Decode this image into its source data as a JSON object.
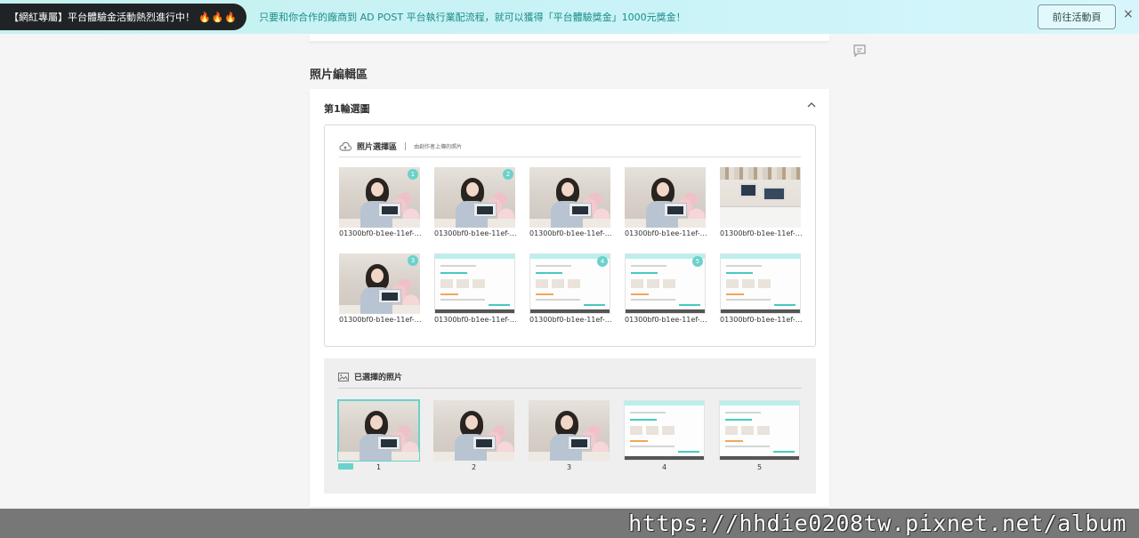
{
  "banner": {
    "badge": "【網紅專屬】平台體驗金活動熱烈進行中！",
    "fire": "🔥🔥🔥",
    "message": "只要和你合作的廠商到 AD POST 平台執行業配流程，就可以獲得「平台體驗獎金」1000元獎金！",
    "cta": "前往活動頁",
    "close": "×"
  },
  "section_title": "照片編輯區",
  "round": {
    "title": "第1輪選圖",
    "picker": {
      "label": "照片選擇區",
      "separator": "|",
      "hint": "由創作者上傳的照片",
      "items": [
        {
          "caption": "01300bf0-b1ee-11ef-…",
          "badge": "1",
          "kind": "photo"
        },
        {
          "caption": "01300bf0-b1ee-11ef-…",
          "badge": "2",
          "kind": "photo"
        },
        {
          "caption": "01300bf0-b1ee-11ef-…",
          "badge": "",
          "kind": "photo"
        },
        {
          "caption": "01300bf0-b1ee-11ef-…",
          "badge": "",
          "kind": "photo"
        },
        {
          "caption": "01300bf0-b1ee-11ef-…",
          "badge": "",
          "kind": "desk"
        },
        {
          "caption": "01300bf0-b1ee-11ef-…",
          "badge": "3",
          "kind": "photo"
        },
        {
          "caption": "01300bf0-b1ee-11ef-…",
          "badge": "",
          "kind": "shot"
        },
        {
          "caption": "01300bf0-b1ee-11ef-…",
          "badge": "4",
          "kind": "shot"
        },
        {
          "caption": "01300bf0-b1ee-11ef-…",
          "badge": "5",
          "kind": "shot"
        },
        {
          "caption": "01300bf0-b1ee-11ef-…",
          "badge": "",
          "kind": "shot"
        }
      ]
    },
    "selected": {
      "label": "已選擇的照片",
      "items": [
        {
          "index": "1",
          "kind": "photo"
        },
        {
          "index": "2",
          "kind": "photo"
        },
        {
          "index": "3",
          "kind": "photo"
        },
        {
          "index": "4",
          "kind": "shot"
        },
        {
          "index": "5",
          "kind": "shot"
        }
      ]
    }
  },
  "watermark": "https://hhdie0208tw.pixnet.net/album",
  "colors": {
    "accent": "#6bd1cb",
    "banner_text": "#1a8c87",
    "badge_bg": "#1f2326"
  }
}
